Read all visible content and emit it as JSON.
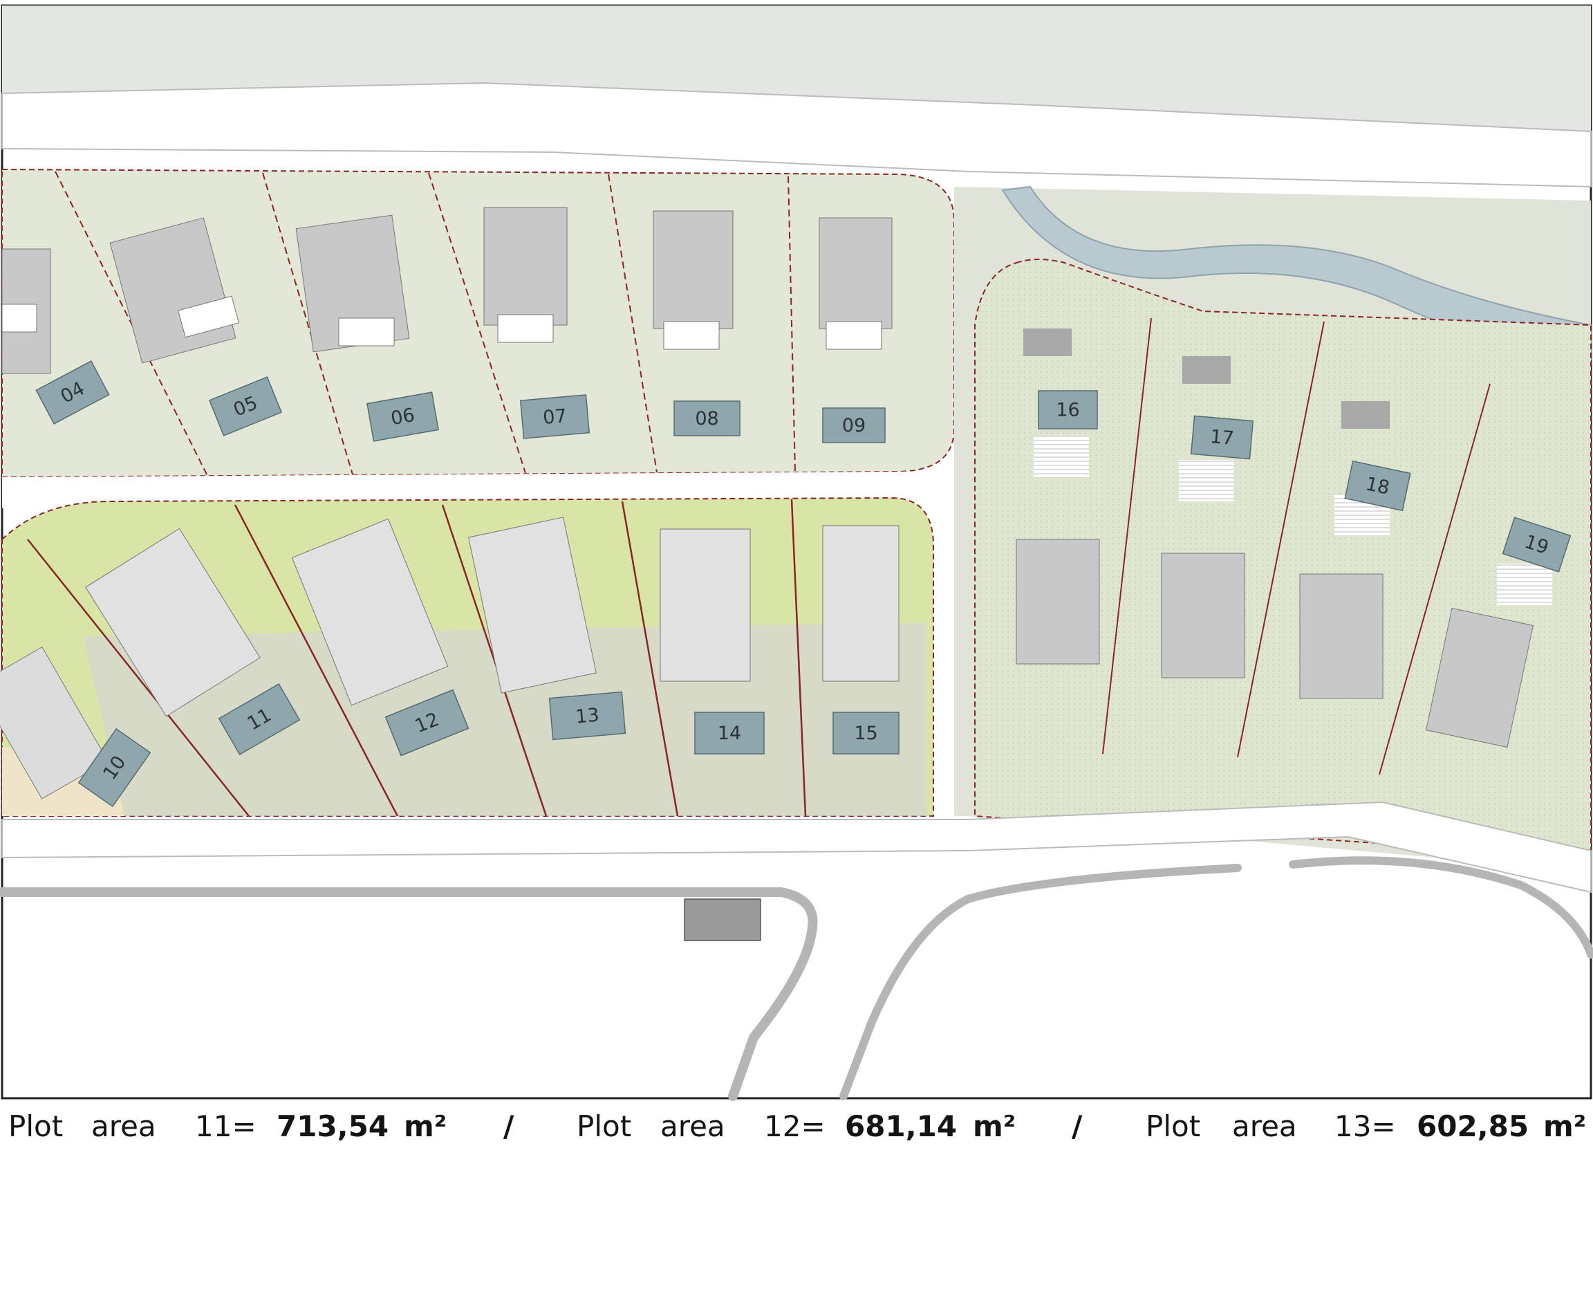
{
  "plots": {
    "labels": [
      "04",
      "05",
      "06",
      "07",
      "08",
      "09",
      "10",
      "11",
      "12",
      "13",
      "14",
      "15",
      "16",
      "17",
      "18",
      "19"
    ]
  },
  "caption": {
    "item1": {
      "prefix": "Plot",
      "word": "area",
      "id": "11=",
      "value": "713,54",
      "unit": "m²"
    },
    "separator1": "/",
    "item2": {
      "prefix": "Plot",
      "word": "area",
      "id": "12=",
      "value": "681,14",
      "unit": "m²"
    },
    "separator2": "/",
    "item3": {
      "prefix": "Plot",
      "word": "area",
      "id": "13=",
      "value": "602,85",
      "unit": "m²"
    }
  },
  "colors": {
    "green_area": "#d9e2c5",
    "bright_green": "#d5e39a",
    "paving": "#ebe8e3",
    "road": "#ffffff",
    "river": "#b8c9cf",
    "building": "#c8c8c8",
    "pool": "#8fa6ad",
    "plot_boundary": "#8a2525",
    "sand": "#f0e4c8"
  }
}
